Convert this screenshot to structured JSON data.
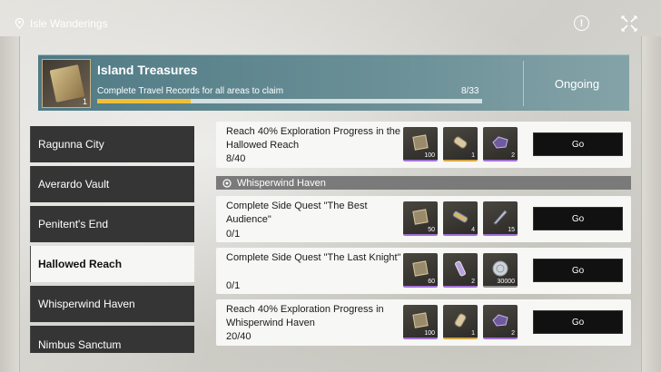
{
  "header": {
    "location": "Isle Wanderings",
    "alert_glyph": "!"
  },
  "banner": {
    "title": "Island Treasures",
    "description": "Complete Travel Records for all areas to claim",
    "progress_text": "8/33",
    "progress_fraction": 0.242,
    "status": "Ongoing",
    "item_qty": "1"
  },
  "sidebar": {
    "items": [
      {
        "label": "Ragunna City"
      },
      {
        "label": "Averardo Vault"
      },
      {
        "label": "Penitent's End"
      },
      {
        "label": "Hallowed Reach",
        "active": true
      },
      {
        "label": "Whisperwind Haven"
      },
      {
        "label": "Nimbus Sanctum"
      }
    ]
  },
  "section": {
    "label": "Whisperwind Haven"
  },
  "quests": [
    {
      "title": "Reach 40% Exploration Progress in the Hallowed Reach",
      "progress": "8/40",
      "go_label": "Go",
      "rewards": [
        {
          "icon": "tome-icon",
          "qty": "100",
          "rarity": "purple"
        },
        {
          "icon": "canister-icon",
          "qty": "1",
          "rarity": "gold"
        },
        {
          "icon": "crystal-icon",
          "qty": "2",
          "rarity": "purple"
        }
      ]
    },
    {
      "title": "Complete Side Quest \"The Best Audience\"",
      "progress": "0/1",
      "go_label": "Go",
      "rewards": [
        {
          "icon": "tome-icon",
          "qty": "50",
          "rarity": "purple"
        },
        {
          "icon": "scroll-icon",
          "qty": "4",
          "rarity": "purple"
        },
        {
          "icon": "blade-icon",
          "qty": "15",
          "rarity": "purple"
        }
      ]
    },
    {
      "title": "Complete Side Quest \"The Last Knight\"",
      "progress": "0/1",
      "go_label": "Go",
      "rewards": [
        {
          "icon": "tome-icon",
          "qty": "60",
          "rarity": "purple"
        },
        {
          "icon": "vial-icon",
          "qty": "2",
          "rarity": "purple"
        },
        {
          "icon": "coin-icon",
          "qty": "30000",
          "rarity": "grey"
        }
      ]
    },
    {
      "title": "Reach 40% Exploration Progress in Whisperwind Haven",
      "progress": "20/40",
      "go_label": "Go",
      "rewards": [
        {
          "icon": "tome-icon",
          "qty": "100",
          "rarity": "purple"
        },
        {
          "icon": "canister-icon",
          "qty": "1",
          "rarity": "gold"
        },
        {
          "icon": "crystal-icon",
          "qty": "2",
          "rarity": "purple"
        }
      ]
    }
  ]
}
